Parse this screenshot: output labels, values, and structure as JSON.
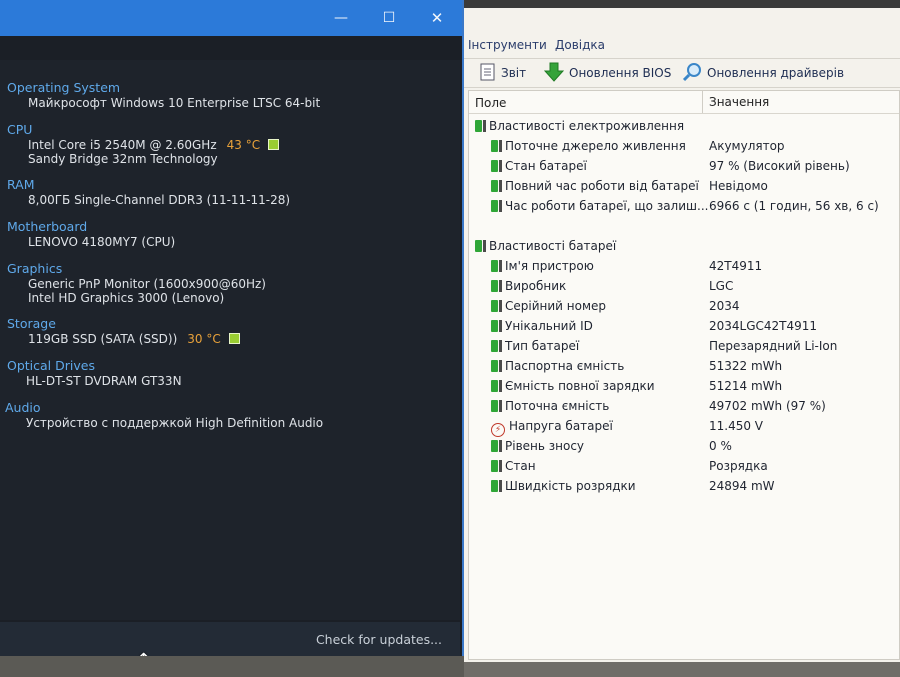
{
  "left": {
    "title_controls": {
      "minimize": "—",
      "maximize": "☐",
      "close": "✕"
    },
    "sections": {
      "os": {
        "title": "Operating System",
        "lines": [
          "Майкрософт Windows 10 Enterprise LTSC 64-bit"
        ]
      },
      "cpu": {
        "title": "CPU",
        "line1": "Intel Core i5 2540M @ 2.60GHz",
        "temp": "43 °C",
        "line2": "Sandy Bridge 32nm Technology"
      },
      "ram": {
        "title": "RAM",
        "line1": "8,00ГБ Single-Channel DDR3 (11-11-11-28)"
      },
      "motherboard": {
        "title": "Motherboard",
        "line1": "LENOVO 4180MY7 (CPU)"
      },
      "graphics": {
        "title": "Graphics",
        "line1": "Generic PnP Monitor (1600x900@60Hz)",
        "line2": "Intel HD Graphics 3000 (Lenovo)"
      },
      "storage": {
        "title": "Storage",
        "line1": "119GB SSD (SATA (SSD))",
        "temp": "30 °C"
      },
      "optical": {
        "title": "Optical Drives",
        "line1": "HL-DT-ST DVDRAM GT33N"
      },
      "audio": {
        "title": "Audio",
        "line1": "Устройство с поддержкой High Definition Audio"
      }
    },
    "footer": {
      "check_updates": "Check for updates..."
    },
    "colors": {
      "accent": "#5fa9ea",
      "temp": "#e8a13a",
      "titlebar": "#2c7ad9"
    }
  },
  "right": {
    "menu": [
      "Інструменти",
      "Довідка"
    ],
    "toolbar": {
      "report": "Звіт",
      "bios_update": "Оновлення BIOS",
      "driver_update": "Оновлення драйверів"
    },
    "columns": {
      "field": "Поле",
      "value": "Значення"
    },
    "group1": {
      "title": "Властивості електроживлення",
      "rows": [
        {
          "field": "Поточне джерело живлення",
          "value": "Акумулятор"
        },
        {
          "field": "Стан батареї",
          "value": "97 % (Високий рівень)"
        },
        {
          "field": "Повний час роботи від батареї",
          "value": "Невідомо"
        },
        {
          "field": "Час роботи батареї, що залиш...",
          "value": "6966 с (1 годин, 56 хв, 6 с)"
        }
      ]
    },
    "group2": {
      "title": "Властивості батареї",
      "rows": [
        {
          "field": "Ім'я пристрою",
          "value": "42T4911"
        },
        {
          "field": "Виробник",
          "value": "LGC"
        },
        {
          "field": "Серійний номер",
          "value": "2034"
        },
        {
          "field": "Унікальний ID",
          "value": "2034LGC42T4911"
        },
        {
          "field": "Тип батареї",
          "value": "Перезарядний Li-Ion"
        },
        {
          "field": "Паспортна ємність",
          "value": "51322 mWh"
        },
        {
          "field": "Ємність повної зарядки",
          "value": "51214 mWh"
        },
        {
          "field": "Поточна ємність",
          "value": "49702 mWh  (97 %)"
        },
        {
          "field": "Напруга батареї",
          "value": "11.450 V"
        },
        {
          "field": "Рівень зносу",
          "value": "0 %"
        },
        {
          "field": "Стан",
          "value": "Розрядка"
        },
        {
          "field": "Швидкість розрядки",
          "value": "24894 mW"
        }
      ]
    }
  }
}
